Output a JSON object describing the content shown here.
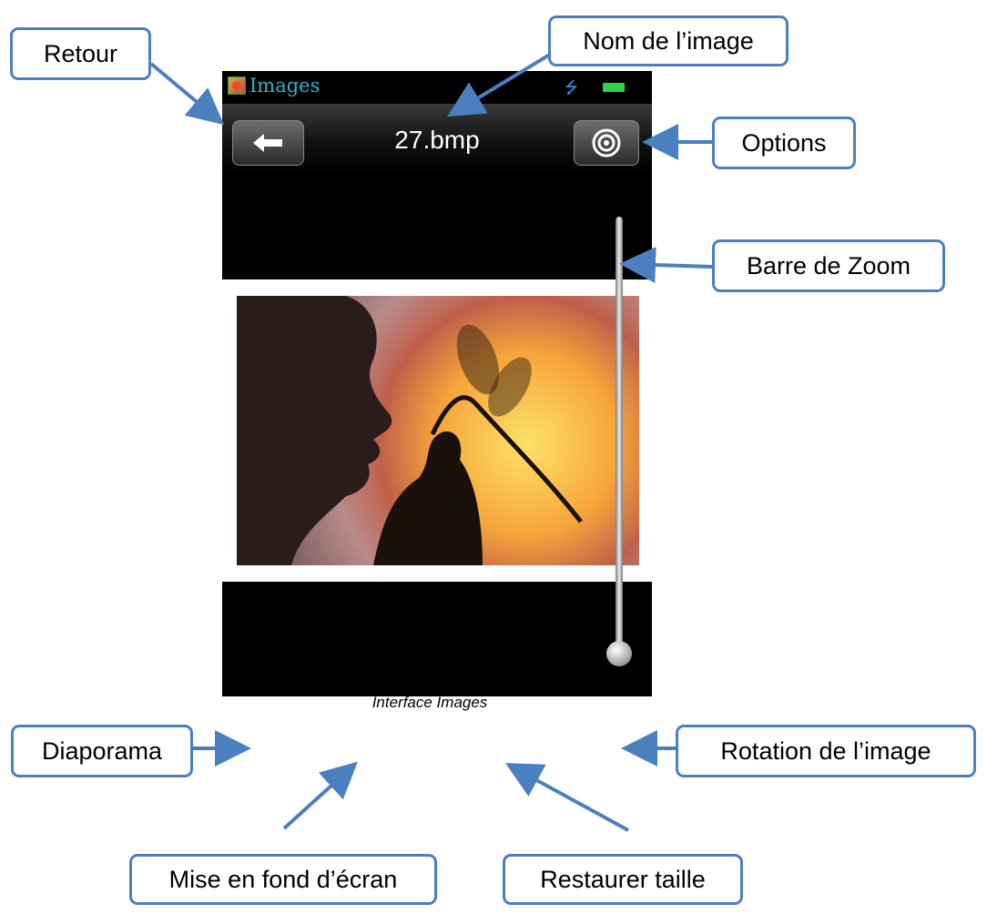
{
  "app": {
    "title": "Images",
    "image_name": "27.bmp"
  },
  "icons": {
    "back": "back-arrow-icon",
    "options": "gear-icon",
    "usb": "usb-icon",
    "battery": "battery-icon",
    "slideshow": "slideshow-icon",
    "wallpaper": "wallpaper-icon",
    "restore_size": "restore-size-icon",
    "rotate": "rotate-icon"
  },
  "callouts": {
    "retour": "Retour",
    "nom_image": "Nom de l’image",
    "options": "Options",
    "zoom": "Barre de Zoom",
    "diaporama": "Diaporama",
    "rotation": "Rotation de l’image",
    "fond_ecran": "Mise en fond d’écran",
    "restaurer": "Restaurer taille"
  },
  "caption": "Interface Images",
  "colors": {
    "callout_border": "#4a7fc0",
    "app_title": "#2fb4c8"
  }
}
